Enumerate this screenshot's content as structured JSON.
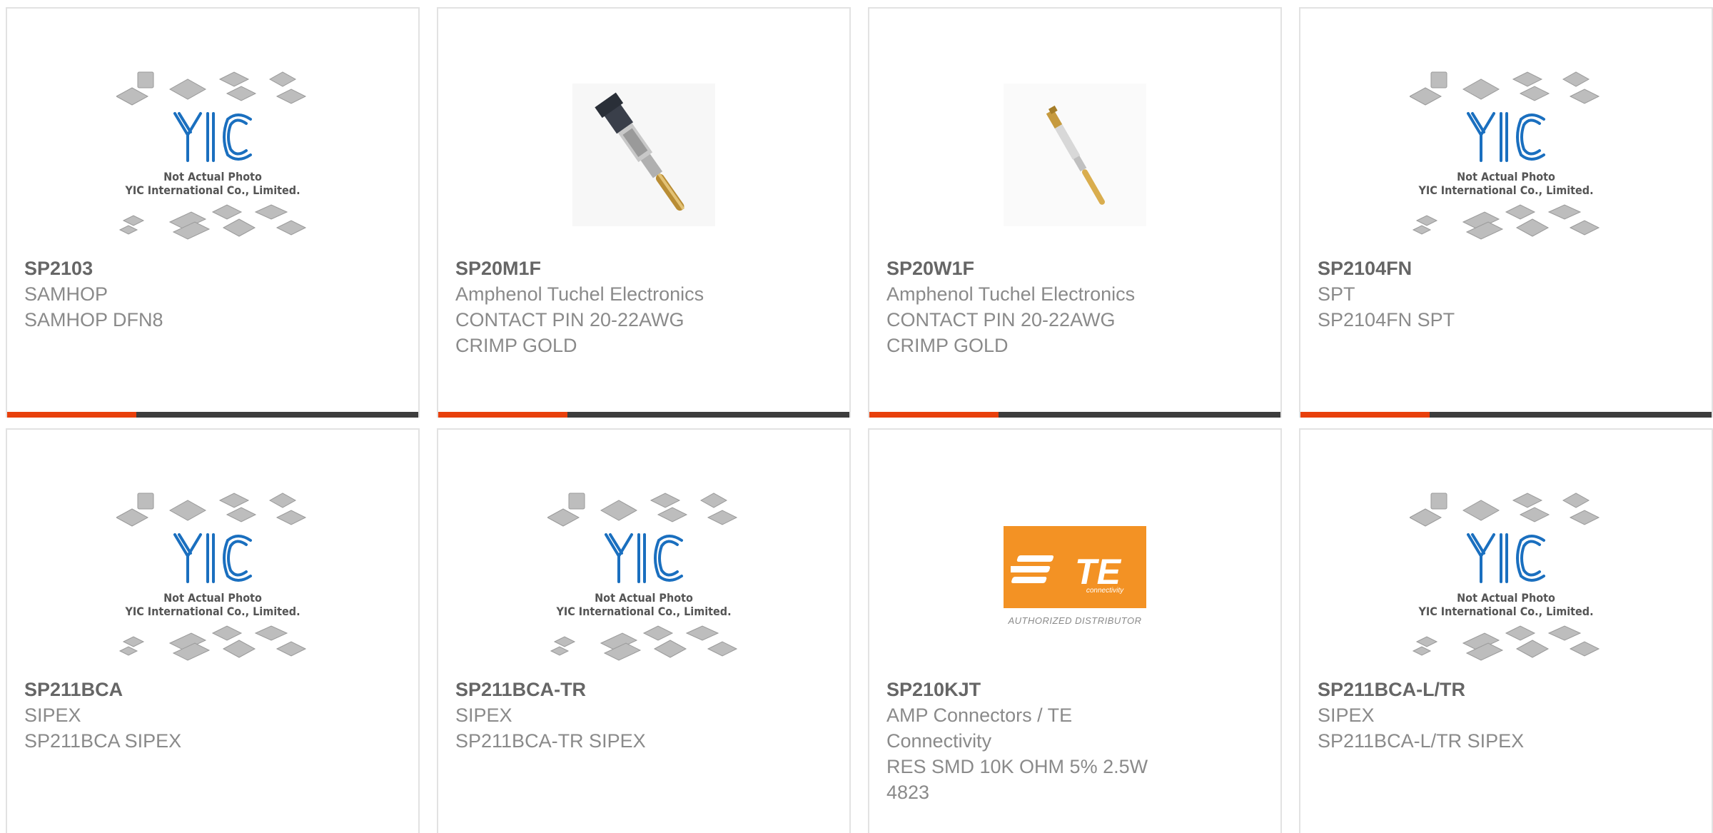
{
  "colors": {
    "accent": "#e8400c",
    "bar": "#3d3d3d",
    "yic_blue": "#1a6fbf",
    "te_orange": "#f39224"
  },
  "placeholder": {
    "caption1": "Not Actual Photo",
    "caption2": "YIC International Co., Limited.",
    "logo_text": "YIC"
  },
  "te_logo": {
    "brand": "TE",
    "tagline": "connectivity",
    "sub": "AUTHORIZED DISTRIBUTOR"
  },
  "products": [
    {
      "part": "SP2103",
      "lines": [
        "SAMHOP",
        "SAMHOP DFN8"
      ],
      "image": "yic-placeholder-icon"
    },
    {
      "part": "SP20M1F",
      "lines": [
        "Amphenol Tuchel Electronics",
        "CONTACT PIN 20-22AWG",
        "CRIMP GOLD"
      ],
      "image": "contact-pin-large-photo"
    },
    {
      "part": "SP20W1F",
      "lines": [
        "Amphenol Tuchel Electronics",
        "CONTACT PIN 20-22AWG",
        "CRIMP GOLD"
      ],
      "image": "contact-pin-small-photo"
    },
    {
      "part": "SP2104FN",
      "lines": [
        "SPT",
        "SP2104FN SPT"
      ],
      "image": "yic-placeholder-icon"
    },
    {
      "part": "SP211BCA",
      "lines": [
        "SIPEX",
        "SP211BCA SIPEX"
      ],
      "image": "yic-placeholder-icon"
    },
    {
      "part": "SP211BCA-TR",
      "lines": [
        "SIPEX",
        "SP211BCA-TR SIPEX"
      ],
      "image": "yic-placeholder-icon"
    },
    {
      "part": "SP210KJT",
      "lines": [
        "AMP Connectors / TE",
        "Connectivity",
        "RES SMD 10K OHM 5% 2.5W",
        "4823"
      ],
      "image": "te-logo-icon"
    },
    {
      "part": "SP211BCA-L/TR",
      "lines": [
        "SIPEX",
        "SP211BCA-L/TR SIPEX"
      ],
      "image": "yic-placeholder-icon"
    }
  ]
}
